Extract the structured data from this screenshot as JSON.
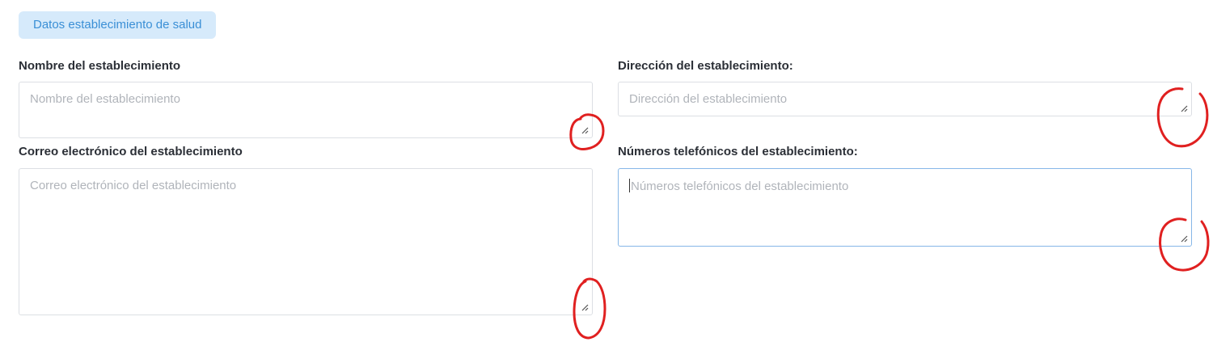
{
  "section": {
    "badge_label": "Datos establecimiento de salud"
  },
  "fields": {
    "nombre": {
      "label": "Nombre del establecimiento",
      "placeholder": "Nombre del establecimiento",
      "value": ""
    },
    "direccion": {
      "label": "Dirección del establecimiento:",
      "placeholder": "Dirección del establecimiento",
      "value": ""
    },
    "correo": {
      "label": "Correo electrónico del establecimiento",
      "placeholder": "Correo electrónico del establecimiento",
      "value": ""
    },
    "telefonos": {
      "label": "Números telefónicos del establecimiento:",
      "placeholder": "Números telefónicos del establecimiento",
      "value": "",
      "focused": true
    }
  },
  "icons": {
    "resize_grip": "resize-grip-icon",
    "annotation": "red-circle-annotation"
  },
  "colors": {
    "badge_bg": "#d6eafb",
    "badge_text": "#3a8fd6",
    "focus_border": "#86b7e8",
    "annotation": "#e02020"
  }
}
